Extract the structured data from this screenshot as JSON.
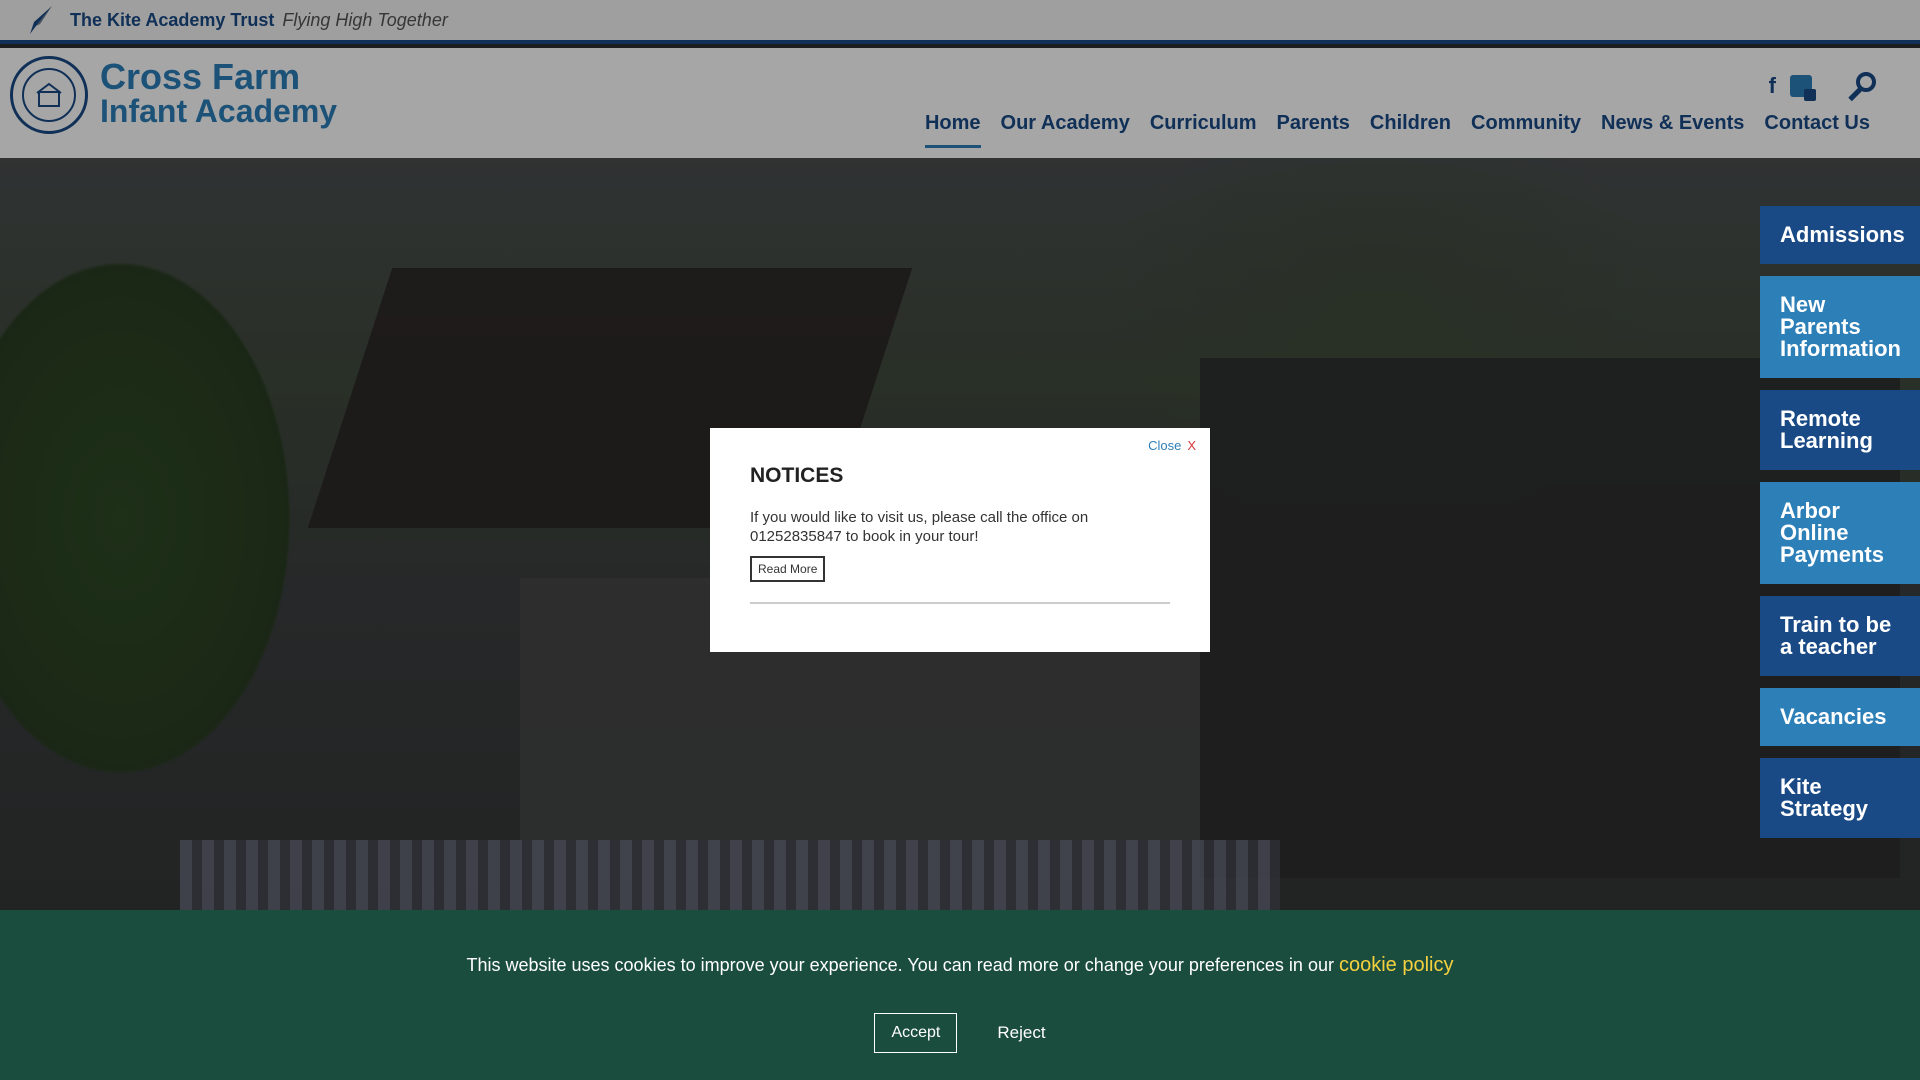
{
  "trust_bar": {
    "name": "The Kite Academy Trust",
    "tagline": "Flying High Together"
  },
  "header": {
    "school_name_line1": "Cross Farm",
    "school_name_line2": "Infant Academy",
    "crest_text": "Cross Farm Infant Academy"
  },
  "nav": {
    "items": [
      {
        "label": "Home",
        "active": true
      },
      {
        "label": "Our Academy"
      },
      {
        "label": "Curriculum"
      },
      {
        "label": "Parents"
      },
      {
        "label": "Children"
      },
      {
        "label": "Community"
      },
      {
        "label": "News & Events"
      },
      {
        "label": "Contact Us"
      }
    ]
  },
  "icons": {
    "facebook": "f",
    "translate": "translate-icon",
    "search": "search-icon"
  },
  "side_links": [
    {
      "label": "Admissions"
    },
    {
      "label": "New Parents Information"
    },
    {
      "label": "Remote Learning"
    },
    {
      "label": "Arbor Online Payments"
    },
    {
      "label": "Train to be a teacher"
    },
    {
      "label": "Vacancies"
    },
    {
      "label": "Kite Strategy"
    }
  ],
  "modal": {
    "close_label": "Close",
    "close_x": "X",
    "title": "NOTICES",
    "text": "If you would like to visit us, please call the office on 01252835847 to book in your tour!",
    "read_more": "Read More"
  },
  "cookie_banner": {
    "text": "This website uses cookies to improve your experience. You can read more or change your preferences in our",
    "link_text": "cookie policy",
    "accept_label": "Accept",
    "reject_label": "Reject"
  },
  "colors": {
    "brand_blue": "#1a4a86",
    "accent_blue": "#2d7fb8",
    "cookie_green": "#1b4d3f",
    "cookie_link": "#f4d03f"
  }
}
